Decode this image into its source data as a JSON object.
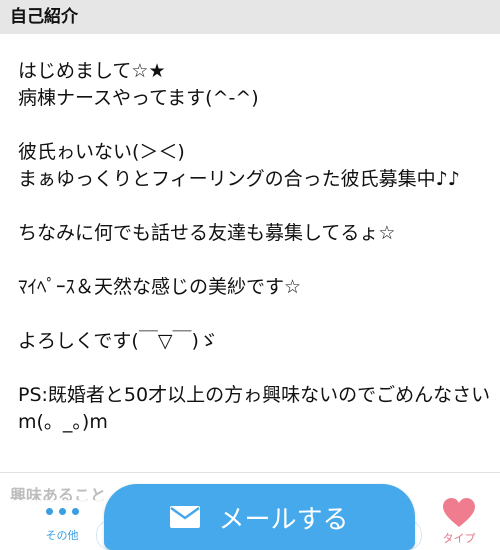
{
  "header": {
    "title": "自己紹介"
  },
  "intro": {
    "paragraphs": [
      "はじめまして☆★\n病棟ナースやってます(^-^)",
      "彼氏ゎいない(＞＜)\nまぁゆっくりとフィーリングの合った彼氏募集中♪♪",
      "ちなみに何でも話せる友達も募集してるょ☆",
      "ﾏｲﾍﾟｰｽ＆天然な感じの美紗です☆",
      "よろしくです(￣▽￣)ゞ",
      "PS:既婚者と50才以上の方ゎ興味ないのでごめんなさいm(。_。)m"
    ]
  },
  "next_section": {
    "title": "興味あること"
  },
  "bottom_bar": {
    "other_label": "その他",
    "mail_label": "メールする",
    "type_label": "タイプ"
  },
  "colors": {
    "accent": "#45a9ec",
    "heart": "#f07d8f",
    "header_bg": "#e6e6e6"
  },
  "icons": [
    "more-dots-icon",
    "mail-icon",
    "heart-icon"
  ]
}
